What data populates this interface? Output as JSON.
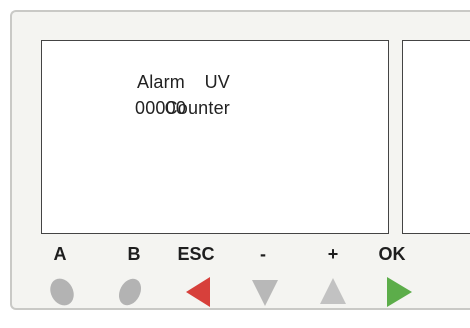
{
  "display": {
    "row1": {
      "label": "UV",
      "value": "Alarm"
    },
    "row2": {
      "label": "Counter",
      "value": "00000"
    }
  },
  "keys": [
    {
      "label": "A",
      "icon": "oval-button-icon",
      "color": "#b3b3b3"
    },
    {
      "label": "B",
      "icon": "oval-button-icon",
      "color": "#b3b3b3"
    },
    {
      "label": "ESC",
      "icon": "arrow-left-icon",
      "color": "#d7403b"
    },
    {
      "label": "-",
      "icon": "arrow-down-icon",
      "color": "#b8b8b8"
    },
    {
      "label": "+",
      "icon": "arrow-up-icon",
      "color": "#c2c2c2"
    },
    {
      "label": "OK",
      "icon": "arrow-right-icon",
      "color": "#5cad4a"
    }
  ]
}
